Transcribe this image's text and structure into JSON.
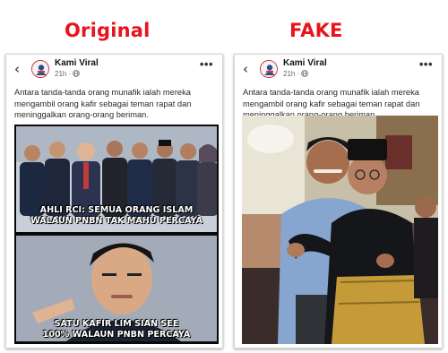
{
  "headings": {
    "original": "Original",
    "fake": "FAKE"
  },
  "post": {
    "account_name": "Kami Viral",
    "time": "21h",
    "privacy_icon": "globe-icon",
    "back_icon": "chevron-left-icon",
    "more_icon": "more-horizontal-icon",
    "more_label": "•••",
    "back_label": "‹",
    "caption": "Antara tanda-tanda orang munafik ialah mereka mengambil orang kafir sebagai teman rapat dan meninggalkan orang-orang beriman."
  },
  "meme": {
    "top_line1": "AHLI RCI: SEMUA ORANG ISLAM",
    "top_line2": "WALAUN PNBN TAK MAHU PERCAYA",
    "bottom_line1": "SATU KAFIR LIM SIAN SEE",
    "bottom_line2": "100% WALAUN PNBN PERCAYA"
  },
  "colors": {
    "heading": "#e8141b",
    "card_border": "#d6d6d6",
    "avatar_ring": "#c73a33"
  }
}
